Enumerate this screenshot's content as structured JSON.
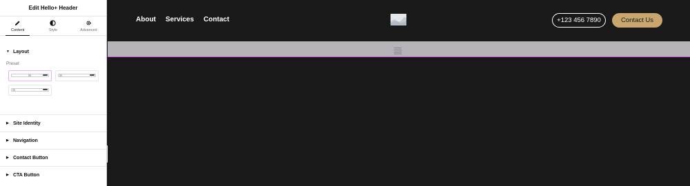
{
  "panel": {
    "title": "Edit Hello+ Header",
    "tabs": [
      {
        "label": "Content",
        "icon": "pencil-icon",
        "active": true
      },
      {
        "label": "Style",
        "icon": "half-circle-icon",
        "active": false
      },
      {
        "label": "Advanced",
        "icon": "gear-icon",
        "active": false
      }
    ],
    "layout_section": {
      "title": "Layout",
      "preset_label": "Preset",
      "selected_preset": 1
    },
    "collapsed_sections": [
      {
        "label": "Site Identity"
      },
      {
        "label": "Navigation"
      },
      {
        "label": "Contact Button"
      },
      {
        "label": "CTA Button"
      }
    ]
  },
  "preview": {
    "background": "#1a191a",
    "nav": [
      {
        "label": "About"
      },
      {
        "label": "Services"
      },
      {
        "label": "Contact"
      }
    ],
    "logo_icon": "image-placeholder-icon",
    "phone_button": "+123 456 7890",
    "cta_button": "Contact Us",
    "cta_color": "#c8a66d",
    "selection_color": "#d946ef"
  }
}
